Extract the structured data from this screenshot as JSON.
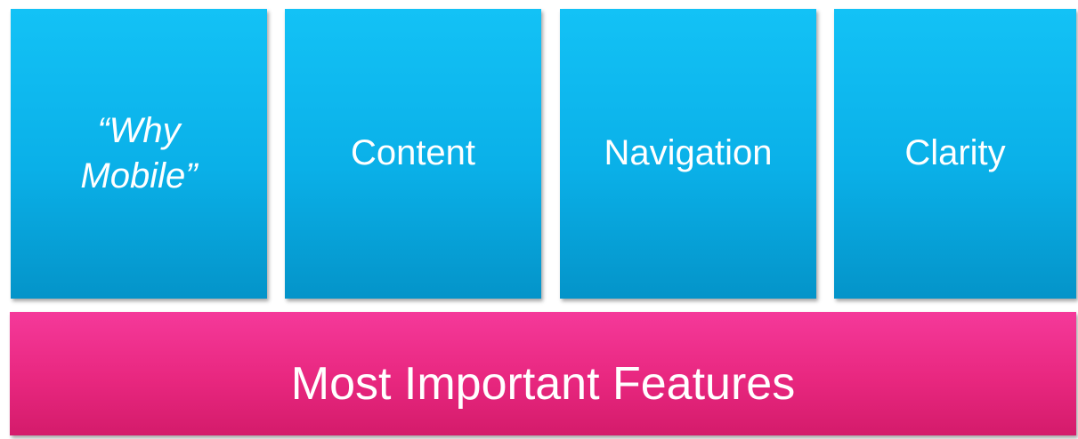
{
  "pillars": [
    {
      "line1": "“Why",
      "line2": "Mobile”"
    },
    {
      "label": "Content"
    },
    {
      "label": "Navigation"
    },
    {
      "label": "Clarity"
    }
  ],
  "base": {
    "label": "Most Important Features"
  },
  "colors": {
    "pillar": "#0ab0e8",
    "base": "#e8277f",
    "text": "#ffffff"
  }
}
